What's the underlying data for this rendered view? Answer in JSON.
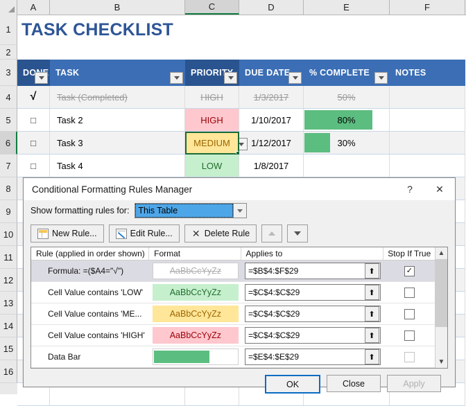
{
  "sheet": {
    "columns": [
      "A",
      "B",
      "C",
      "D",
      "E",
      "F"
    ],
    "selected_column": "C",
    "rows": [
      "1",
      "2",
      "3",
      "4",
      "5",
      "6",
      "7",
      "8",
      "9",
      "10",
      "11",
      "12",
      "13",
      "14",
      "15",
      "16"
    ],
    "selected_row": "6",
    "title": "TASK CHECKLIST",
    "headers": {
      "done": "DONE",
      "task": "TASK",
      "priority": "PRIORITY",
      "due_date": "DUE DATE",
      "percent_complete": "% COMPLETE",
      "notes": "NOTES"
    },
    "tasks": [
      {
        "done": "√",
        "task": "Task (Completed)",
        "priority": "HIGH",
        "due_date": "1/3/2017",
        "percent": "50%",
        "percent_value": 50,
        "notes": "",
        "completed": true
      },
      {
        "done": "□",
        "task": "Task 2",
        "priority": "HIGH",
        "due_date": "1/10/2017",
        "percent": "80%",
        "percent_value": 80,
        "notes": "",
        "completed": false
      },
      {
        "done": "□",
        "task": "Task 3",
        "priority": "MEDIUM",
        "due_date": "1/12/2017",
        "percent": "30%",
        "percent_value": 30,
        "notes": "",
        "completed": false
      },
      {
        "done": "□",
        "task": "Task 4",
        "priority": "LOW",
        "due_date": "1/8/2017",
        "percent": "",
        "percent_value": 0,
        "notes": "",
        "completed": false
      }
    ],
    "colors": {
      "header_blue": "#3b6eb5",
      "header_blue_dark": "#2a5490",
      "title_blue": "#2e5596",
      "high": "#ffc7ce",
      "medium": "#ffe699",
      "low": "#c6efce",
      "data_bar_green": "#5cbd80",
      "selection_green": "#107c41"
    }
  },
  "dialog": {
    "title": "Conditional Formatting Rules Manager",
    "help_icon": "?",
    "close_icon": "✕",
    "show_rules_label": "Show formatting rules for:",
    "show_rules_value": "This Table",
    "toolbar": {
      "new_rule": "New Rule...",
      "edit_rule": "Edit Rule...",
      "delete_rule": "Delete Rule",
      "move_up": "▲",
      "move_down": "▼"
    },
    "table_headers": {
      "rule": "Rule (applied in order shown)",
      "format": "Format",
      "applies_to": "Applies to",
      "stop_if_true": "Stop If True"
    },
    "rules": [
      {
        "rule": "Formula: =($A4=\"√\")",
        "format_preview": "AaBbCcYyZz",
        "format_style": "strike",
        "applies_to": "=$B$4:$F$29",
        "stop_if_true": true,
        "stop_enabled": true,
        "selected": true
      },
      {
        "rule": "Cell Value contains 'LOW'",
        "format_preview": "AaBbCcYyZz",
        "format_style": "green",
        "applies_to": "=$C$4:$C$29",
        "stop_if_true": false,
        "stop_enabled": true,
        "selected": false
      },
      {
        "rule": "Cell Value contains 'ME...",
        "format_preview": "AaBbCcYyZz",
        "format_style": "yellow",
        "applies_to": "=$C$4:$C$29",
        "stop_if_true": false,
        "stop_enabled": true,
        "selected": false
      },
      {
        "rule": "Cell Value contains 'HIGH'",
        "format_preview": "AaBbCcYyZz",
        "format_style": "pink",
        "applies_to": "=$C$4:$C$29",
        "stop_if_true": false,
        "stop_enabled": true,
        "selected": false
      },
      {
        "rule": "Data Bar",
        "format_preview": "",
        "format_style": "bar",
        "applies_to": "=$E$4:$E$29",
        "stop_if_true": false,
        "stop_enabled": false,
        "selected": false
      }
    ],
    "range_picker_icon": "⬆",
    "checked_glyph": "✓",
    "footer": {
      "ok": "OK",
      "close": "Close",
      "apply": "Apply",
      "apply_disabled": true
    }
  }
}
